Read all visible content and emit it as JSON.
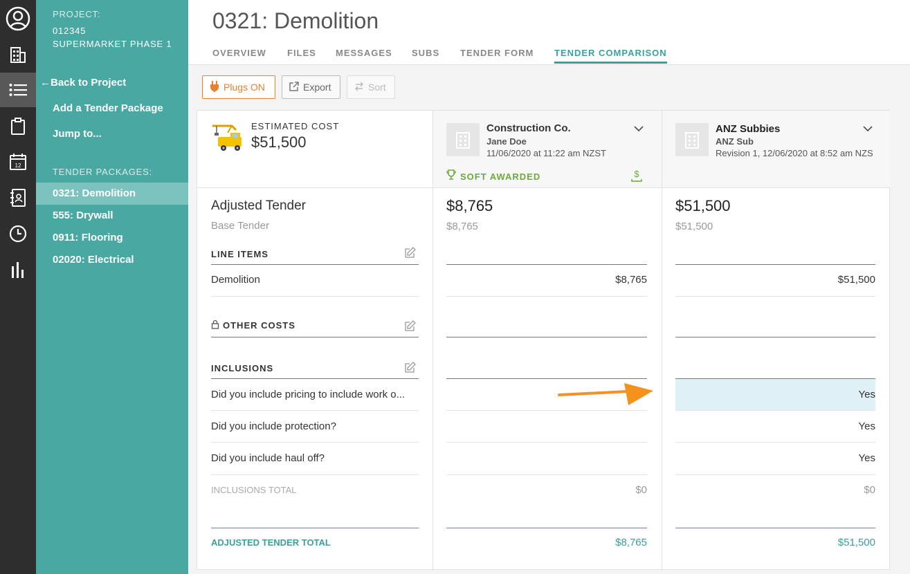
{
  "sidebar": {
    "project_label": "PROJECT:",
    "project_number": "012345",
    "project_name": "SUPERMARKET PHASE 1",
    "back_link": "Back to Project",
    "add_package": "Add a Tender Package",
    "jump_to": "Jump to...",
    "packages_label": "TENDER PACKAGES:",
    "packages": [
      {
        "label": "0321: Demolition",
        "active": true
      },
      {
        "label": "555: Drywall",
        "active": false
      },
      {
        "label": "0911: Flooring",
        "active": false
      },
      {
        "label": "02020: Electrical",
        "active": false
      }
    ]
  },
  "rail_icons": [
    "user-icon",
    "building-icon",
    "list-icon",
    "clipboard-icon",
    "calendar-icon",
    "address-book-icon",
    "clock-icon",
    "bar-chart-icon"
  ],
  "calendar_day": "12",
  "header": {
    "title": "0321: Demolition",
    "tabs": [
      "OVERVIEW",
      "FILES",
      "MESSAGES",
      "SUBS",
      "TENDER FORM",
      "TENDER COMPARISON"
    ],
    "active_tab": "TENDER COMPARISON"
  },
  "toolbar": {
    "plugs": "Plugs ON",
    "export": "Export",
    "sort": "Sort"
  },
  "estimate": {
    "label": "ESTIMATED COST",
    "value": "$51,500"
  },
  "left": {
    "adjusted_tender": "Adjusted Tender",
    "base_tender": "Base Tender",
    "line_items": "LINE ITEMS",
    "demolition": "Demolition",
    "other_costs": "OTHER COSTS",
    "inclusions": "INCLUSIONS",
    "questions": [
      "Did you include pricing to include work o...",
      "Did you include protection?",
      "Did you include haul off?"
    ],
    "inclusions_total": "INCLUSIONS TOTAL",
    "adjusted_total": "ADJUSTED TENDER TOTAL"
  },
  "bidders": [
    {
      "company": "Construction Co.",
      "contact": "Jane Doe",
      "date": "11/06/2020 at 11:22 am NZST",
      "badge": "SOFT AWARDED",
      "adjusted": "$8,765",
      "base": "$8,765",
      "demolition": "$8,765",
      "answers": [
        "",
        "",
        ""
      ],
      "inclusions_total": "$0",
      "total": "$8,765"
    },
    {
      "company": "ANZ Subbies",
      "contact": "ANZ Sub",
      "date": "Revision 1, 12/06/2020 at 8:52 am NZS",
      "badge": "",
      "adjusted": "$51,500",
      "base": "$51,500",
      "demolition": "$51,500",
      "answers": [
        "Yes",
        "Yes",
        "Yes"
      ],
      "inclusions_total": "$0",
      "total": "$51,500"
    }
  ],
  "colors": {
    "teal": "#4aa8a3",
    "accent": "#3aa09b",
    "orange": "#e8822e",
    "highlight": "#dff0f7",
    "award_green": "#6aaa3a"
  }
}
